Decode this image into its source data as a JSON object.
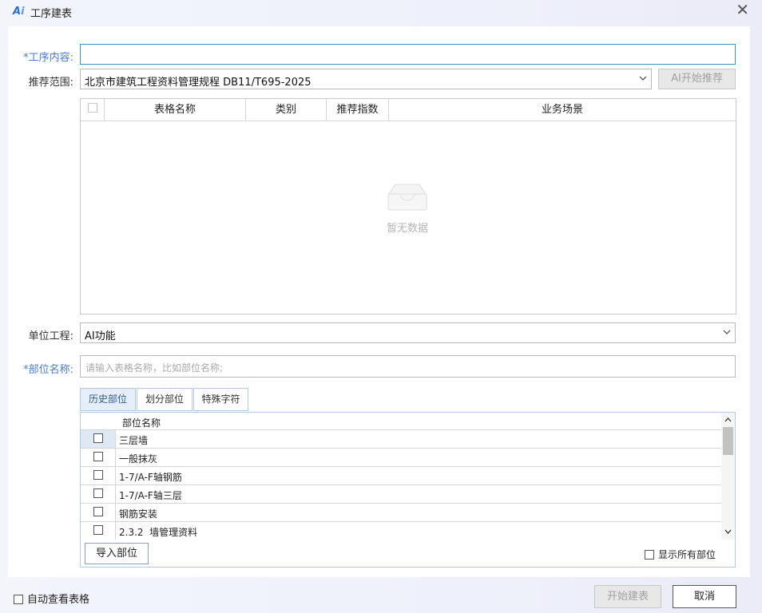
{
  "window": {
    "logo": "Ai",
    "title": "工序建表",
    "close": "✕"
  },
  "form": {
    "process_label": "*工序内容:",
    "process_value": "",
    "scope_label": "推荐范围:",
    "scope_value": "北京市建筑工程资料管理规程  DB11/T695-2025",
    "recommend_button": "AI开始推荐",
    "unit_label": "单位工程:",
    "unit_value": "AI功能",
    "part_label": "*部位名称:",
    "part_placeholder": "请输入表格名称，比如部位名称;"
  },
  "recommend_table": {
    "columns": [
      "表格名称",
      "类别",
      "推荐指数",
      "业务场景"
    ],
    "empty_text": "暂无数据"
  },
  "tabs": [
    {
      "label": "历史部位",
      "active": true
    },
    {
      "label": "划分部位",
      "active": false
    },
    {
      "label": "特殊字符",
      "active": false
    }
  ],
  "parts_table": {
    "header": "部位名称",
    "rows": [
      "三层墙",
      "一般抹灰",
      "1-7/A-F轴钢筋",
      "1-7/A-F轴三层",
      "钢筋安装",
      "2.3.2  墙管理资料"
    ],
    "import_button": "导入部位",
    "show_all_label": "显示所有部位"
  },
  "footer": {
    "auto_view_label": "自动查看表格",
    "start_button": "开始建表",
    "cancel_button": "取消"
  }
}
